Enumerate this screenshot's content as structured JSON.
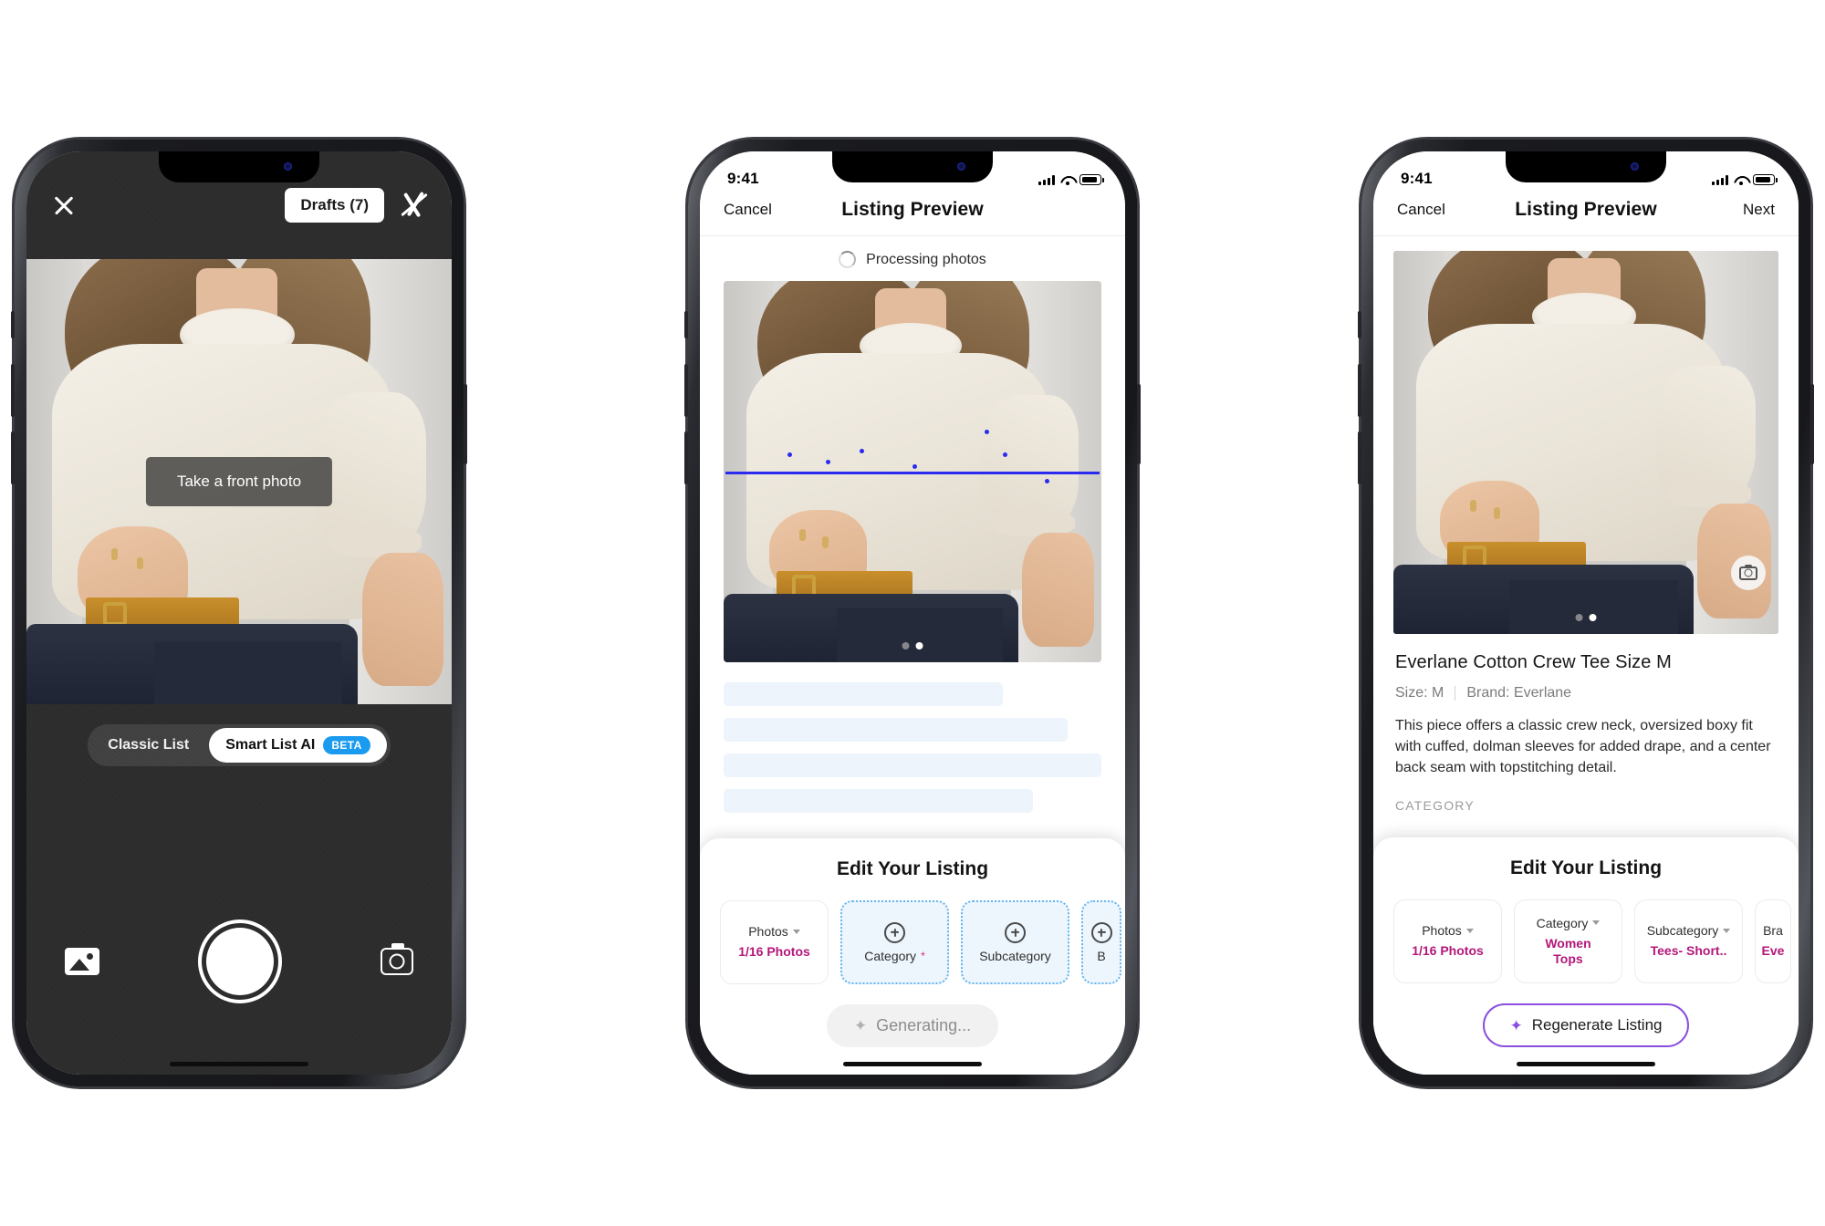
{
  "phone1": {
    "name": "camera-capture-screen",
    "statusbar": {
      "time": "",
      "icons": [
        "signal-icon",
        "wifi-icon",
        "battery-icon"
      ]
    },
    "topbar": {
      "close_icon": "close-icon",
      "drafts_label": "Drafts (7)",
      "flash_icon": "flash-off-icon"
    },
    "viewfinder": {
      "hint": "Take a front photo"
    },
    "modes": {
      "classic": "Classic List",
      "smart": "Smart List AI",
      "badge": "BETA"
    },
    "controls": {
      "gallery_icon": "gallery-icon",
      "shutter_icon": "shutter-button",
      "flip_icon": "flip-camera-icon"
    }
  },
  "phone2": {
    "name": "listing-preview-processing",
    "statusbar": {
      "time": "9:41"
    },
    "nav": {
      "left": "Cancel",
      "title": "Listing Preview",
      "right": ""
    },
    "processing": {
      "label": "Processing photos",
      "spinner_icon": "spinner-icon"
    },
    "carousel": {
      "dots": 2,
      "active_index": 1
    },
    "sheet": {
      "title": "Edit Your Listing",
      "chips": [
        {
          "label": "Photos",
          "value": "1/16 Photos",
          "highlighted": false,
          "required": false,
          "icon": "chevron-down-icon"
        },
        {
          "label": "Category",
          "value": "",
          "highlighted": true,
          "required": true,
          "icon": "plus-circle-icon"
        },
        {
          "label": "Subcategory",
          "value": "",
          "highlighted": true,
          "required": false,
          "icon": "plus-circle-icon"
        },
        {
          "label": "B",
          "value": "",
          "highlighted": true,
          "required": false,
          "icon": "plus-circle-icon"
        }
      ],
      "action": {
        "label": "Generating...",
        "icon": "sparkle-icon",
        "state": "disabled"
      }
    }
  },
  "phone3": {
    "name": "listing-preview-generated",
    "statusbar": {
      "time": "9:41"
    },
    "nav": {
      "left": "Cancel",
      "title": "Listing Preview",
      "right": "Next"
    },
    "carousel": {
      "dots": 2,
      "active_index": 1,
      "camera_icon": "camera-icon"
    },
    "listing": {
      "title": "Everlane Cotton Crew Tee Size M",
      "size": "Size: M",
      "brand": "Brand: Everlane",
      "description": "This piece offers a classic crew neck, oversized boxy fit with cuffed, dolman sleeves for added drape, and a center back seam with topstitching detail.",
      "section_label": "CATEGORY"
    },
    "sheet": {
      "title": "Edit Your Listing",
      "chips": [
        {
          "label": "Photos",
          "value": "1/16 Photos",
          "icon": "chevron-down-icon"
        },
        {
          "label": "Category",
          "value": "Women\nTops",
          "icon": "chevron-down-icon"
        },
        {
          "label": "Subcategory",
          "value": "Tees- Short..",
          "icon": "chevron-down-icon"
        },
        {
          "label": "Bra",
          "value": "Eve",
          "icon": "chevron-down-icon"
        }
      ],
      "action": {
        "label": "Regenerate Listing",
        "icon": "sparkle-icon",
        "state": "enabled"
      }
    }
  },
  "colors": {
    "accent_pink": "#b3177a",
    "accent_purple": "#8a4fe0",
    "beta_blue": "#1a9bef",
    "highlight_blue": "#64b5f0",
    "detect_blue": "#2b2bf0"
  }
}
